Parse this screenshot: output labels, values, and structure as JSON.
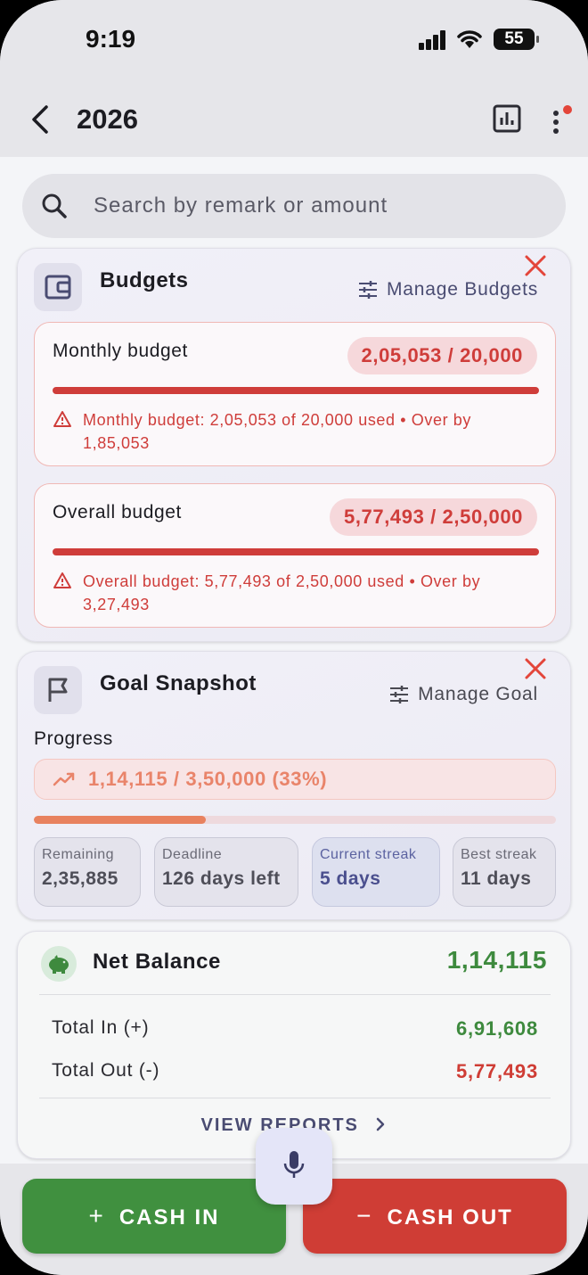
{
  "status_bar": {
    "time": "9:19",
    "battery": "55"
  },
  "app_bar": {
    "title": "2026"
  },
  "search": {
    "placeholder": "Search by remark or amount"
  },
  "budgets": {
    "title": "Budgets",
    "manage_label": "Manage Budgets",
    "monthly": {
      "label": "Monthly budget",
      "amount": "2,05,053 / 20,000",
      "warning": "Monthly budget: 2,05,053 of 20,000 used • Over by 1,85,053",
      "progress": 1.0
    },
    "overall": {
      "label": "Overall budget",
      "amount": "5,77,493 / 2,50,000",
      "warning": "Overall budget: 5,77,493 of 2,50,000 used • Over by 3,27,493",
      "progress": 1.0
    }
  },
  "goal": {
    "title": "Goal Snapshot",
    "manage_label": "Manage Goal",
    "progress_label": "Progress",
    "progress_text": "1,14,115 / 3,50,000 (33%)",
    "progress": 0.33,
    "stats": [
      {
        "label": "Remaining",
        "value": "2,35,885"
      },
      {
        "label": "Deadline",
        "value": "126 days left"
      },
      {
        "label": "Current streak",
        "value": "5 days"
      },
      {
        "label": "Best streak",
        "value": "11 days"
      }
    ]
  },
  "net_balance": {
    "title": "Net Balance",
    "amount": "1,14,115",
    "total_in_label": "Total In (+)",
    "total_in": "6,91,608",
    "total_out_label": "Total Out (-)",
    "total_out": "5,77,493",
    "view_reports": "VIEW REPORTS"
  },
  "actions": {
    "cash_in": "CASH IN",
    "cash_out": "CASH OUT"
  },
  "colors": {
    "green": "#40903f",
    "red": "#cf3d35",
    "accent": "#4a4c72",
    "goal_orange": "#e8825f"
  }
}
